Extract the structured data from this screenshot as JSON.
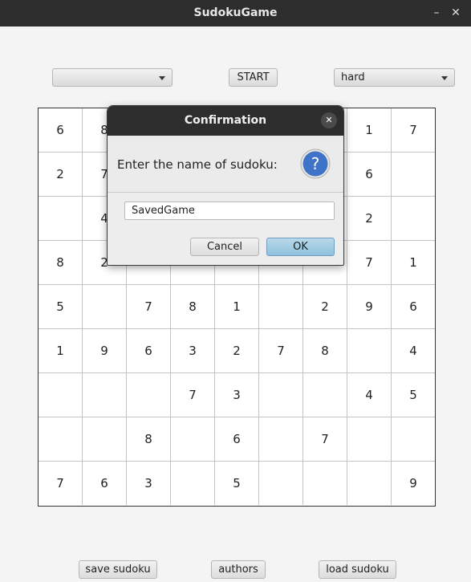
{
  "window": {
    "title": "SudokuGame",
    "minimize_glyph": "–",
    "close_glyph": "✕"
  },
  "toolbar": {
    "left_select_value": "",
    "start_label": "START",
    "difficulty_value": "hard"
  },
  "grid": {
    "rows": [
      [
        "6",
        "8",
        "",
        "",
        "",
        "",
        "",
        "1",
        "7"
      ],
      [
        "2",
        "7",
        "",
        "",
        "",
        "",
        "",
        "6",
        ""
      ],
      [
        "",
        "4",
        "",
        "",
        "",
        "",
        "",
        "2",
        ""
      ],
      [
        "8",
        "2",
        "",
        "",
        "",
        "",
        "",
        "7",
        "1"
      ],
      [
        "5",
        "",
        "7",
        "8",
        "1",
        "",
        "2",
        "9",
        "6"
      ],
      [
        "1",
        "9",
        "6",
        "3",
        "2",
        "7",
        "8",
        "",
        "4"
      ],
      [
        "",
        "",
        "",
        "7",
        "3",
        "",
        "",
        "4",
        "5"
      ],
      [
        "",
        "",
        "8",
        "",
        "6",
        "",
        "7",
        "",
        ""
      ],
      [
        "7",
        "6",
        "3",
        "",
        "5",
        "",
        "",
        "",
        "9"
      ]
    ]
  },
  "bottom": {
    "save_label": "save sudoku",
    "authors_label": "authors",
    "load_label": "load sudoku"
  },
  "dialog": {
    "title": "Confirmation",
    "close_glyph": "✕",
    "prompt": "Enter the name of sudoku:",
    "icon": "question-icon",
    "input_value": "SavedGame",
    "cancel_label": "Cancel",
    "ok_label": "OK"
  },
  "colors": {
    "titlebar": "#2d2d2d",
    "question_icon": "#3f73c8",
    "ok_button": "#a5cde3"
  }
}
